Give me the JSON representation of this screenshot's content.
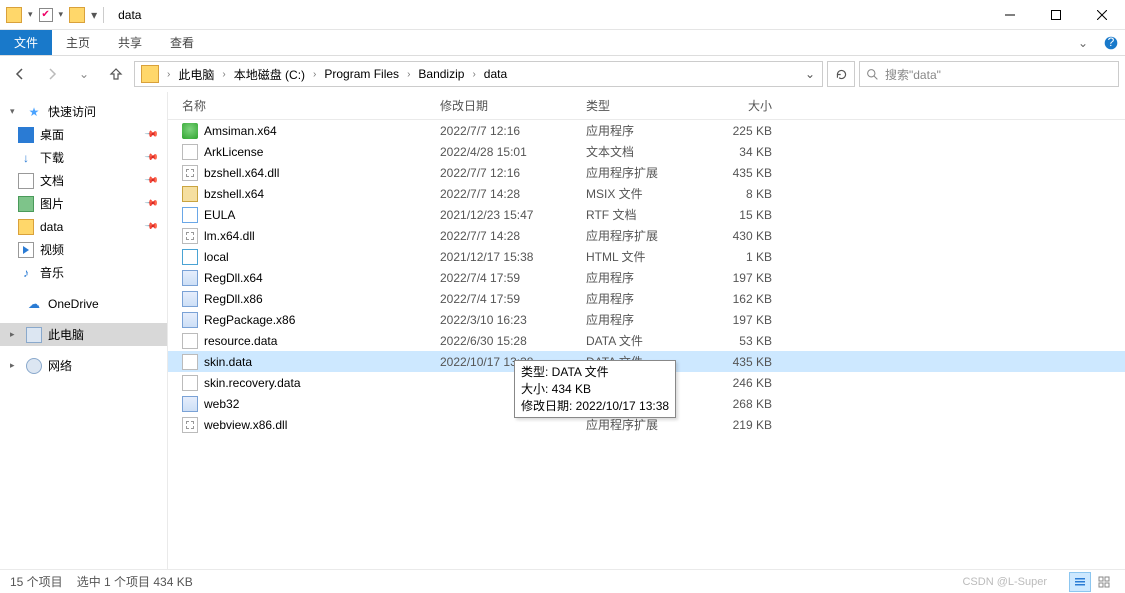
{
  "window": {
    "title": "data"
  },
  "ribbon": {
    "file": "文件",
    "tabs": [
      "主页",
      "共享",
      "查看"
    ]
  },
  "breadcrumb": {
    "segments": [
      "此电脑",
      "本地磁盘 (C:)",
      "Program Files",
      "Bandizip",
      "data"
    ]
  },
  "search": {
    "placeholder": "搜索\"data\""
  },
  "nav": {
    "quick": "快速访问",
    "quick_items": [
      {
        "label": "桌面",
        "icon": "desktop",
        "pin": true
      },
      {
        "label": "下载",
        "icon": "dl",
        "pin": true
      },
      {
        "label": "文档",
        "icon": "doc",
        "pin": true
      },
      {
        "label": "图片",
        "icon": "pic",
        "pin": true
      },
      {
        "label": "data",
        "icon": "fld",
        "pin": true
      },
      {
        "label": "视频",
        "icon": "vid",
        "pin": false
      },
      {
        "label": "音乐",
        "icon": "music",
        "pin": false
      }
    ],
    "onedrive": "OneDrive",
    "thispc": "此电脑",
    "network": "网络"
  },
  "columns": {
    "name": "名称",
    "date": "修改日期",
    "type": "类型",
    "size": "大小"
  },
  "files": [
    {
      "name": "Amsiman.x64",
      "date": "2022/7/7 12:16",
      "type": "应用程序",
      "size": "225 KB",
      "icon": "shield"
    },
    {
      "name": "ArkLicense",
      "date": "2022/4/28 15:01",
      "type": "文本文档",
      "size": "34 KB",
      "icon": "txt"
    },
    {
      "name": "bzshell.x64.dll",
      "date": "2022/7/7 12:16",
      "type": "应用程序扩展",
      "size": "435 KB",
      "icon": "dll"
    },
    {
      "name": "bzshell.x64",
      "date": "2022/7/7 14:28",
      "type": "MSIX 文件",
      "size": "8 KB",
      "icon": "zip"
    },
    {
      "name": "EULA",
      "date": "2021/12/23 15:47",
      "type": "RTF 文档",
      "size": "15 KB",
      "icon": "rtf"
    },
    {
      "name": "lm.x64.dll",
      "date": "2022/7/7 14:28",
      "type": "应用程序扩展",
      "size": "430 KB",
      "icon": "dll"
    },
    {
      "name": "local",
      "date": "2021/12/17 15:38",
      "type": "HTML 文件",
      "size": "1 KB",
      "icon": "html"
    },
    {
      "name": "RegDll.x64",
      "date": "2022/7/4 17:59",
      "type": "应用程序",
      "size": "197 KB",
      "icon": "exe"
    },
    {
      "name": "RegDll.x86",
      "date": "2022/7/4 17:59",
      "type": "应用程序",
      "size": "162 KB",
      "icon": "exe"
    },
    {
      "name": "RegPackage.x86",
      "date": "2022/3/10 16:23",
      "type": "应用程序",
      "size": "197 KB",
      "icon": "exe"
    },
    {
      "name": "resource.data",
      "date": "2022/6/30 15:28",
      "type": "DATA 文件",
      "size": "53 KB",
      "icon": "data"
    },
    {
      "name": "skin.data",
      "date": "2022/10/17 13:38",
      "type": "DATA 文件",
      "size": "435 KB",
      "icon": "data",
      "selected": true
    },
    {
      "name": "skin.recovery.data",
      "date": "",
      "type": "DATA 文件",
      "size": "246 KB",
      "icon": "data"
    },
    {
      "name": "web32",
      "date": "",
      "type": "应用程序",
      "size": "268 KB",
      "icon": "exe"
    },
    {
      "name": "webview.x86.dll",
      "date": "",
      "type": "应用程序扩展",
      "size": "219 KB",
      "icon": "dll"
    }
  ],
  "tooltip": {
    "type_label": "类型: DATA 文件",
    "size_label": "大小: 434 KB",
    "date_label": "修改日期: 2022/10/17 13:38"
  },
  "status": {
    "count": "15 个项目",
    "selection": "选中 1 个项目  434 KB",
    "watermark": "CSDN @L-Super"
  }
}
